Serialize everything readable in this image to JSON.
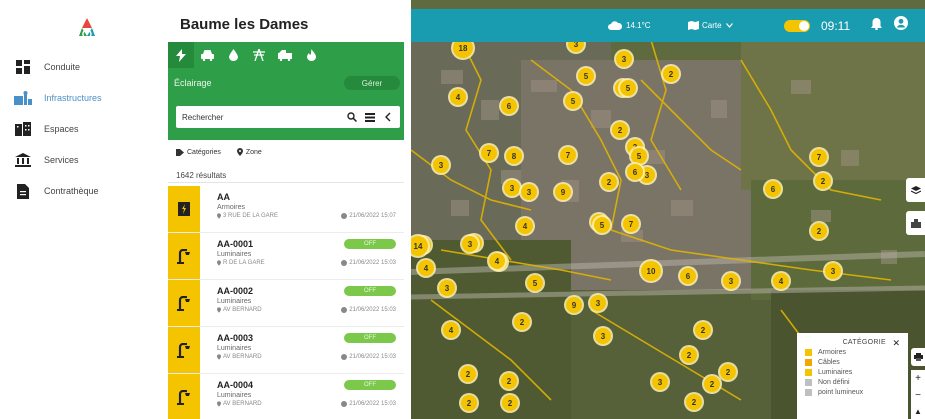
{
  "nav": {
    "items": [
      {
        "label": "Conduite",
        "icon": "dashboard-icon",
        "active": false
      },
      {
        "label": "Infrastructures",
        "icon": "infrastructure-icon",
        "active": true
      },
      {
        "label": "Espaces",
        "icon": "buildings-icon",
        "active": false
      },
      {
        "label": "Services",
        "icon": "institution-icon",
        "active": false
      },
      {
        "label": "Contrathèque",
        "icon": "document-icon",
        "active": false
      }
    ]
  },
  "panel": {
    "title": "Baume les Dames",
    "category_tabs": [
      "lightning-icon",
      "car-icon",
      "drop-icon",
      "pylon-icon",
      "fire-truck-icon",
      "flame-icon"
    ],
    "layer_label": "Éclairage",
    "manage_label": "Gérer",
    "search_placeholder": "Rechercher",
    "filters": [
      "Catégories",
      "Zone"
    ],
    "results_count": "1642 résultats"
  },
  "results": [
    {
      "code": "AA",
      "type": "Armoires",
      "address": "3 RUE DE LA GARE",
      "date": "21/06/2022 15:07",
      "tag": "",
      "icon": "cabinet-icon"
    },
    {
      "code": "AA-0001",
      "type": "Luminaires",
      "address": "R DE LA GARE",
      "date": "21/06/2022 15:03",
      "tag": "OFF",
      "icon": "streetlight-icon"
    },
    {
      "code": "AA-0002",
      "type": "Luminaires",
      "address": "AV BERNARD",
      "date": "21/06/2022 15:03",
      "tag": "OFF",
      "icon": "streetlight-icon"
    },
    {
      "code": "AA-0003",
      "type": "Luminaires",
      "address": "AV BERNARD",
      "date": "21/06/2022 15:03",
      "tag": "OFF",
      "icon": "streetlight-icon"
    },
    {
      "code": "AA-0004",
      "type": "Luminaires",
      "address": "AV BERNARD",
      "date": "21/06/2022 15:03",
      "tag": "OFF",
      "icon": "streetlight-icon"
    }
  ],
  "topbar": {
    "temperature": "14.1°C",
    "map_mode": "Carte",
    "time": "09:11"
  },
  "legend": {
    "title": "CATÉGORIE",
    "items": [
      {
        "label": "Armoires",
        "color": "#f5c400"
      },
      {
        "label": "Câbles",
        "color": "#f0a800"
      },
      {
        "label": "Luminaires",
        "color": "#f5c400"
      },
      {
        "label": "Non défini",
        "color": "#bfbfbf"
      },
      {
        "label": "point lumineux",
        "color": "#bfbfbf"
      }
    ]
  },
  "map_markers": [
    {
      "label": "18"
    },
    {
      "label": "3"
    },
    {
      "label": "3"
    },
    {
      "label": "5"
    },
    {
      "label": "4"
    },
    {
      "label": "6"
    },
    {
      "label": "2"
    },
    {
      "label": "5"
    },
    {
      "label": "4"
    },
    {
      "label": "8"
    },
    {
      "label": "7"
    },
    {
      "label": "2"
    },
    {
      "label": "7"
    },
    {
      "label": "3"
    },
    {
      "label": "3"
    },
    {
      "label": "3"
    },
    {
      "label": "2"
    },
    {
      "label": "7"
    },
    {
      "label": "9"
    },
    {
      "label": "2"
    },
    {
      "label": "5"
    },
    {
      "label": "3"
    },
    {
      "label": "2"
    },
    {
      "label": "6"
    },
    {
      "label": "4"
    },
    {
      "label": "4"
    },
    {
      "label": "5"
    },
    {
      "label": "2"
    },
    {
      "label": "4"
    },
    {
      "label": "3"
    },
    {
      "label": "2"
    },
    {
      "label": "14"
    },
    {
      "label": "3"
    },
    {
      "label": "4"
    },
    {
      "label": "4"
    },
    {
      "label": "3"
    },
    {
      "label": "10"
    },
    {
      "label": "6"
    },
    {
      "label": "3"
    },
    {
      "label": "4"
    },
    {
      "label": "3"
    },
    {
      "label": "5"
    },
    {
      "label": "9"
    },
    {
      "label": "3"
    },
    {
      "label": "2"
    },
    {
      "label": "4"
    },
    {
      "label": "3"
    },
    {
      "label": "2"
    },
    {
      "label": "2"
    },
    {
      "label": "2"
    },
    {
      "label": "2"
    },
    {
      "label": "2"
    },
    {
      "label": "3"
    },
    {
      "label": "2"
    },
    {
      "label": "2"
    },
    {
      "label": "2"
    },
    {
      "label": "2"
    },
    {
      "label": "6"
    },
    {
      "label": "7"
    },
    {
      "label": "5"
    }
  ]
}
